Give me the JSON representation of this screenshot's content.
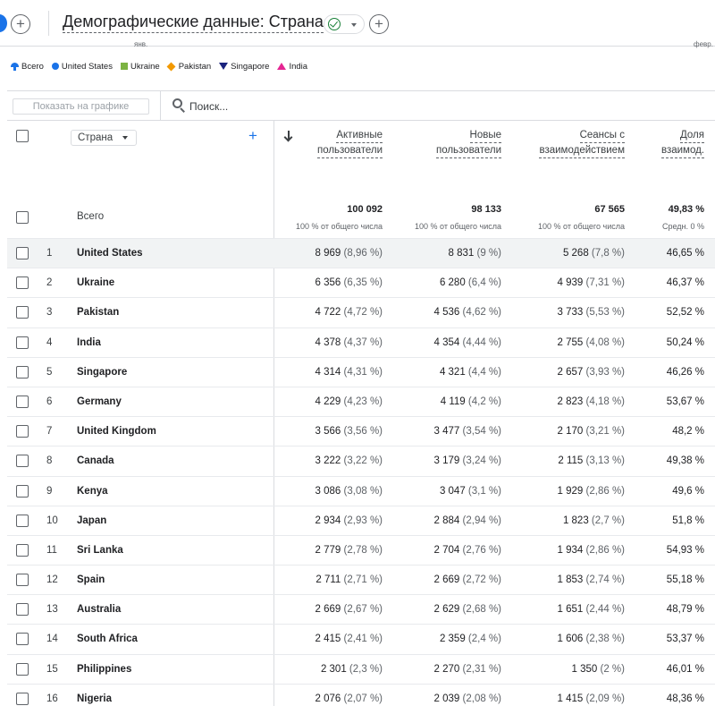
{
  "header": {
    "title": "Демографические данные: Страна",
    "axis_fragments": [
      "янв.",
      "февр."
    ]
  },
  "legend": [
    {
      "label": "Всего",
      "marker": "pin-icon",
      "color": "#1a73e8"
    },
    {
      "label": "United States",
      "marker": "circle",
      "color": "#1a73e8"
    },
    {
      "label": "Ukraine",
      "marker": "square",
      "color": "#7cb342"
    },
    {
      "label": "Pakistan",
      "marker": "diamond",
      "color": "#f29900"
    },
    {
      "label": "Singapore",
      "marker": "triangle-down",
      "color": "#1a237e"
    },
    {
      "label": "India",
      "marker": "triangle-up",
      "color": "#e52592"
    }
  ],
  "toolbar": {
    "show_on_chart": "Показать на графике",
    "search_placeholder": "Поиск..."
  },
  "table": {
    "dimension": "Страна",
    "columns": [
      {
        "line1": "Активные",
        "line2": "пользователи"
      },
      {
        "line1": "Новые",
        "line2": "пользователи"
      },
      {
        "line1": "Сеансы с",
        "line2": "взаимодействием"
      },
      {
        "line1": "Доля",
        "line2": "взаимод."
      }
    ],
    "totals": {
      "label": "Всего",
      "values": [
        "100 092",
        "98 133",
        "67 565",
        "49,83 %"
      ],
      "subs": [
        "100 % от общего числа",
        "100 % от общего числа",
        "100 % от общего числа",
        "Средн. 0 %"
      ]
    },
    "rows": [
      {
        "idx": "1",
        "country": "United States",
        "active": "8 969",
        "active_pct": "(8,96 %)",
        "new": "8 831",
        "new_pct": "(9 %)",
        "sessions": "5 268",
        "sessions_pct": "(7,8 %)",
        "rate": "46,65 %"
      },
      {
        "idx": "2",
        "country": "Ukraine",
        "active": "6 356",
        "active_pct": "(6,35 %)",
        "new": "6 280",
        "new_pct": "(6,4 %)",
        "sessions": "4 939",
        "sessions_pct": "(7,31 %)",
        "rate": "46,37 %"
      },
      {
        "idx": "3",
        "country": "Pakistan",
        "active": "4 722",
        "active_pct": "(4,72 %)",
        "new": "4 536",
        "new_pct": "(4,62 %)",
        "sessions": "3 733",
        "sessions_pct": "(5,53 %)",
        "rate": "52,52 %"
      },
      {
        "idx": "4",
        "country": "India",
        "active": "4 378",
        "active_pct": "(4,37 %)",
        "new": "4 354",
        "new_pct": "(4,44 %)",
        "sessions": "2 755",
        "sessions_pct": "(4,08 %)",
        "rate": "50,24 %"
      },
      {
        "idx": "5",
        "country": "Singapore",
        "active": "4 314",
        "active_pct": "(4,31 %)",
        "new": "4 321",
        "new_pct": "(4,4 %)",
        "sessions": "2 657",
        "sessions_pct": "(3,93 %)",
        "rate": "46,26 %"
      },
      {
        "idx": "6",
        "country": "Germany",
        "active": "4 229",
        "active_pct": "(4,23 %)",
        "new": "4 119",
        "new_pct": "(4,2 %)",
        "sessions": "2 823",
        "sessions_pct": "(4,18 %)",
        "rate": "53,67 %"
      },
      {
        "idx": "7",
        "country": "United Kingdom",
        "active": "3 566",
        "active_pct": "(3,56 %)",
        "new": "3 477",
        "new_pct": "(3,54 %)",
        "sessions": "2 170",
        "sessions_pct": "(3,21 %)",
        "rate": "48,2 %"
      },
      {
        "idx": "8",
        "country": "Canada",
        "active": "3 222",
        "active_pct": "(3,22 %)",
        "new": "3 179",
        "new_pct": "(3,24 %)",
        "sessions": "2 115",
        "sessions_pct": "(3,13 %)",
        "rate": "49,38 %"
      },
      {
        "idx": "9",
        "country": "Kenya",
        "active": "3 086",
        "active_pct": "(3,08 %)",
        "new": "3 047",
        "new_pct": "(3,1 %)",
        "sessions": "1 929",
        "sessions_pct": "(2,86 %)",
        "rate": "49,6 %"
      },
      {
        "idx": "10",
        "country": "Japan",
        "active": "2 934",
        "active_pct": "(2,93 %)",
        "new": "2 884",
        "new_pct": "(2,94 %)",
        "sessions": "1 823",
        "sessions_pct": "(2,7 %)",
        "rate": "51,8 %"
      },
      {
        "idx": "11",
        "country": "Sri Lanka",
        "active": "2 779",
        "active_pct": "(2,78 %)",
        "new": "2 704",
        "new_pct": "(2,76 %)",
        "sessions": "1 934",
        "sessions_pct": "(2,86 %)",
        "rate": "54,93 %"
      },
      {
        "idx": "12",
        "country": "Spain",
        "active": "2 711",
        "active_pct": "(2,71 %)",
        "new": "2 669",
        "new_pct": "(2,72 %)",
        "sessions": "1 853",
        "sessions_pct": "(2,74 %)",
        "rate": "55,18 %"
      },
      {
        "idx": "13",
        "country": "Australia",
        "active": "2 669",
        "active_pct": "(2,67 %)",
        "new": "2 629",
        "new_pct": "(2,68 %)",
        "sessions": "1 651",
        "sessions_pct": "(2,44 %)",
        "rate": "48,79 %"
      },
      {
        "idx": "14",
        "country": "South Africa",
        "active": "2 415",
        "active_pct": "(2,41 %)",
        "new": "2 359",
        "new_pct": "(2,4 %)",
        "sessions": "1 606",
        "sessions_pct": "(2,38 %)",
        "rate": "53,37 %"
      },
      {
        "idx": "15",
        "country": "Philippines",
        "active": "2 301",
        "active_pct": "(2,3 %)",
        "new": "2 270",
        "new_pct": "(2,31 %)",
        "sessions": "1 350",
        "sessions_pct": "(2 %)",
        "rate": "46,01 %"
      },
      {
        "idx": "16",
        "country": "Nigeria",
        "active": "2 076",
        "active_pct": "(2,07 %)",
        "new": "2 039",
        "new_pct": "(2,08 %)",
        "sessions": "1 415",
        "sessions_pct": "(2,09 %)",
        "rate": "48,36 %"
      }
    ]
  }
}
